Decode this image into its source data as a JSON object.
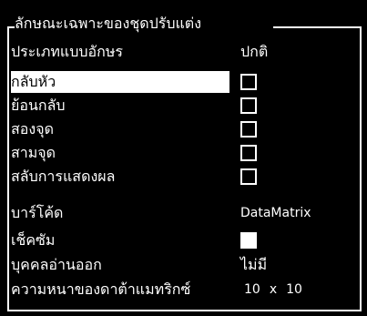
{
  "title": "ลักษณะเฉพาะของชุดปรับแต่ง",
  "rows": [
    {
      "label": "ประเภทแบบอักษร",
      "value": "ปกติ"
    },
    {
      "label": "กลับหัว",
      "checked": false
    },
    {
      "label": "ย้อนกลับ",
      "checked": false
    },
    {
      "label": "สองจุด",
      "checked": false
    },
    {
      "label": "สามจุด",
      "checked": false
    },
    {
      "label": "สลับการแสดงผล",
      "checked": false
    },
    {
      "label": "บาร์โค้ด",
      "value": "DataMatrix"
    },
    {
      "label": "เช็คซัม",
      "checked": true
    },
    {
      "label": "บุคคลอ่านออก",
      "value": "ไม่มี"
    },
    {
      "label": "ความหนาของดาต้าแมทริกซ์",
      "value_a": "10",
      "separator": "x",
      "value_b": "10"
    }
  ],
  "selected_row": "กลับหัว"
}
